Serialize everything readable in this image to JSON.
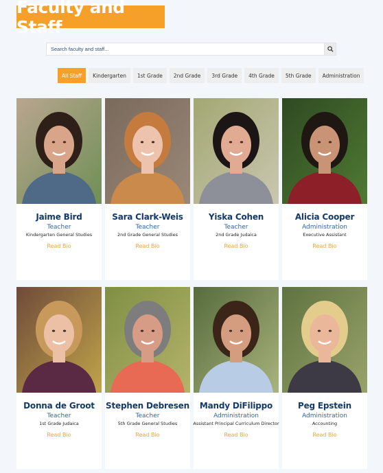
{
  "header": {
    "title": "Faculty and Staff",
    "accent_color": "#f6a02a"
  },
  "search": {
    "placeholder": "Search faculty and staff...",
    "value": "",
    "icon": "search-icon"
  },
  "filters": [
    {
      "label": "All Staff",
      "active": true
    },
    {
      "label": "Kindergarten",
      "active": false
    },
    {
      "label": "1st Grade",
      "active": false
    },
    {
      "label": "2nd Grade",
      "active": false
    },
    {
      "label": "3rd Grade",
      "active": false
    },
    {
      "label": "4th Grade",
      "active": false
    },
    {
      "label": "5th Grade",
      "active": false
    },
    {
      "label": "Administration",
      "active": false
    }
  ],
  "staff": [
    {
      "name": "Jaime Bird",
      "role": "Teacher",
      "department": "Kindergarten General Studies",
      "link": "Read Bio",
      "photo": {
        "bg": "#b9a58f",
        "bg2": "#6f8f56",
        "hair": "#2e2018",
        "skin": "#d9a58a",
        "shirt": "#4f6a86"
      }
    },
    {
      "name": "Sara Clark-Weis",
      "role": "Teacher",
      "department": "2nd Grade General Studies",
      "link": "Read Bio",
      "photo": {
        "bg": "#7a6a5c",
        "bg2": "#9a8877",
        "hair": "#c57a3e",
        "skin": "#edc3ad",
        "shirt": "#c98a4c"
      }
    },
    {
      "name": "Yiska Cohen",
      "role": "Teacher",
      "department": "2nd Grade Judaica",
      "link": "Read Bio",
      "photo": {
        "bg": "#a3a772",
        "bg2": "#c9c7b0",
        "hair": "#1b1515",
        "skin": "#e0ab92",
        "shirt": "#8d9099"
      }
    },
    {
      "name": "Alicia Cooper",
      "role": "Administration",
      "department": "Executive Assistant",
      "link": "Read Bio",
      "photo": {
        "bg": "#2f4a22",
        "bg2": "#4f7a33",
        "hair": "#1f1712",
        "skin": "#c99376",
        "shirt": "#8c1f28"
      }
    },
    {
      "name": "Donna de Groot",
      "role": "Teacher",
      "department": "1st Grade Judaica",
      "link": "Read Bio",
      "photo": {
        "bg": "#6f4a3a",
        "bg2": "#c0a44a",
        "hair": "#c79a5c",
        "skin": "#ecc0a5",
        "shirt": "#5a2a45"
      }
    },
    {
      "name": "Stephen Debresen",
      "role": "Teacher",
      "department": "5th Grade General Studies",
      "link": "Read Bio",
      "photo": {
        "bg": "#7f8f44",
        "bg2": "#b4b36a",
        "hair": "#7d7d7d",
        "skin": "#d79c85",
        "shirt": "#e86a55"
      }
    },
    {
      "name": "Mandy DiFilippo",
      "role": "Administration",
      "department": "Assistant Principal Curriculum Director",
      "link": "Read Bio",
      "photo": {
        "bg": "#566b3c",
        "bg2": "#a9b37d",
        "hair": "#3a2518",
        "skin": "#d49d7f",
        "shirt": "#b9cce6"
      }
    },
    {
      "name": "Peg Epstein",
      "role": "Administration",
      "department": "Accounting",
      "link": "Read Bio",
      "photo": {
        "bg": "#5f7340",
        "bg2": "#99a36a",
        "hair": "#e3cc8c",
        "skin": "#eab79b",
        "shirt": "#3d3a45"
      }
    }
  ]
}
